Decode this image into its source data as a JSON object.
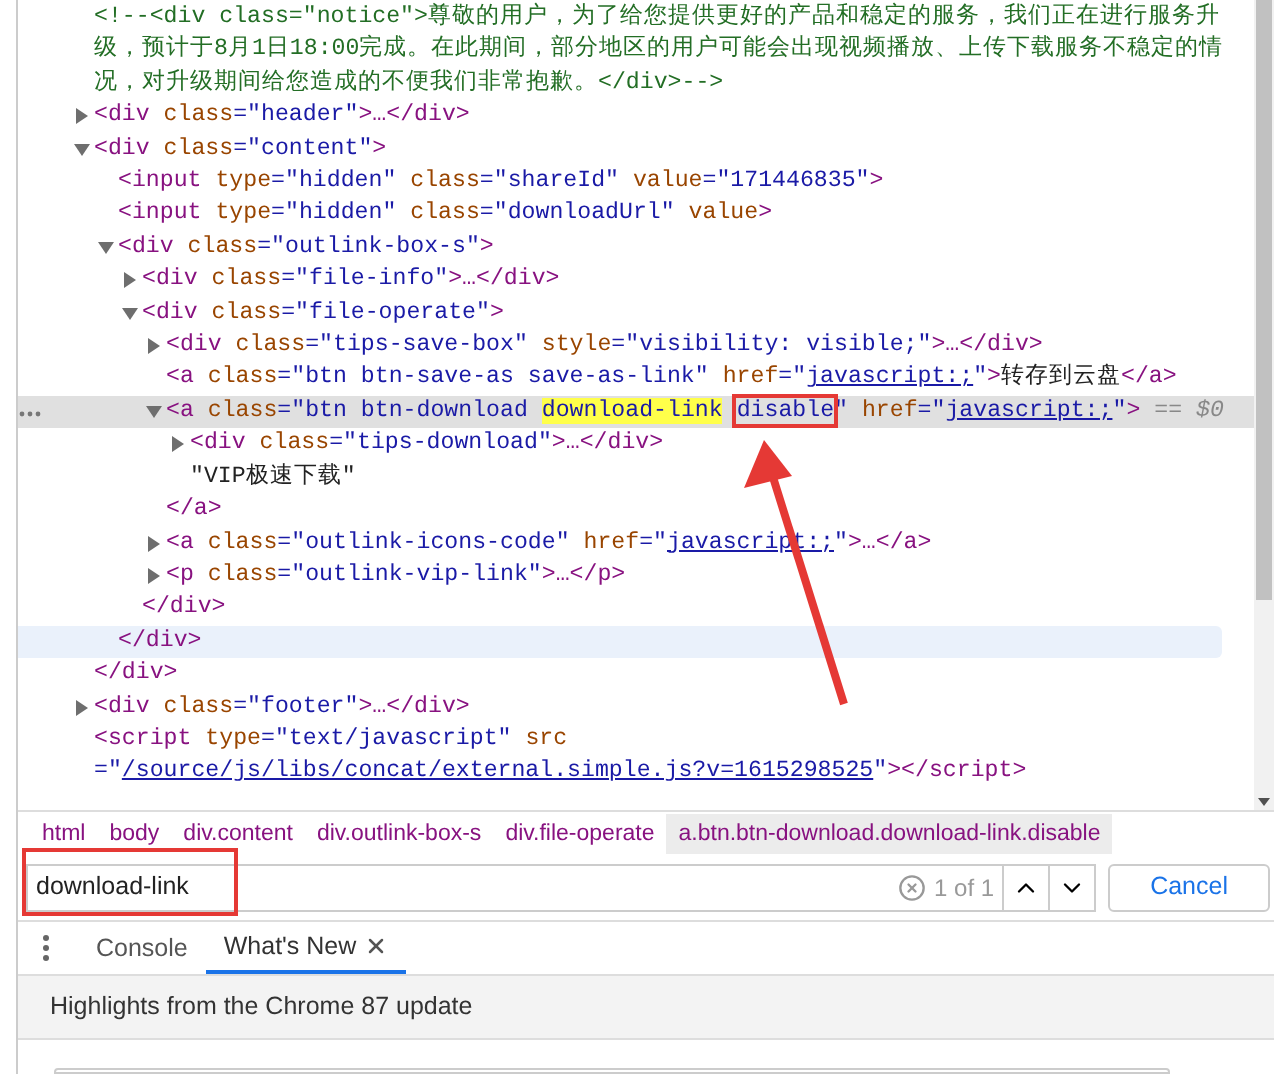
{
  "elements": {
    "nodes": [
      {
        "kind": "comment",
        "text": "<!--<div class=\"notice\">尊敬的用户，为了给您提供更好的产品和稳定的服务，我们正在进行服务升级，预计于8月1日18:00完成。在此期间，部分地区的用户可能会出现视频播放、上传下载服务不稳定的情况，对升级期间给您造成的不便我们非常抱歉。</div>-->"
      },
      {
        "kind": "element",
        "expanded": false,
        "selected": false,
        "tokens": [
          {
            "kind": "tag",
            "text": "<div"
          },
          {
            "kind": "attr",
            "text": " class"
          },
          {
            "kind": "value",
            "text": "=\"header\""
          },
          {
            "kind": "tag",
            "text": ">…</div>"
          }
        ]
      },
      {
        "kind": "element",
        "expanded": true,
        "selected": false,
        "close_hovered": false,
        "tokens": [
          {
            "kind": "tag",
            "text": "<div"
          },
          {
            "kind": "attr",
            "text": " class"
          },
          {
            "kind": "value",
            "text": "=\"content\""
          },
          {
            "kind": "tag",
            "text": ">"
          }
        ],
        "close": "</div>",
        "children": [
          {
            "kind": "element",
            "selected": false,
            "tokens": [
              {
                "kind": "tag",
                "text": "<input"
              },
              {
                "kind": "attr",
                "text": " type"
              },
              {
                "kind": "value",
                "text": "=\"hidden\""
              },
              {
                "kind": "attr",
                "text": " class"
              },
              {
                "kind": "value",
                "text": "=\"shareId\""
              },
              {
                "kind": "attr",
                "text": " value"
              },
              {
                "kind": "value",
                "text": "=\"171446835\""
              },
              {
                "kind": "tag",
                "text": ">"
              }
            ]
          },
          {
            "kind": "element",
            "selected": false,
            "tokens": [
              {
                "kind": "tag",
                "text": "<input"
              },
              {
                "kind": "attr",
                "text": " type"
              },
              {
                "kind": "value",
                "text": "=\"hidden\""
              },
              {
                "kind": "attr",
                "text": " class"
              },
              {
                "kind": "value",
                "text": "=\"downloadUrl\""
              },
              {
                "kind": "attr",
                "text": " value"
              },
              {
                "kind": "tag",
                "text": ">"
              }
            ]
          },
          {
            "kind": "element",
            "expanded": true,
            "selected": false,
            "close_hovered": true,
            "tokens": [
              {
                "kind": "tag",
                "text": "<div"
              },
              {
                "kind": "attr",
                "text": " class"
              },
              {
                "kind": "value",
                "text": "=\"outlink-box-s\""
              },
              {
                "kind": "tag",
                "text": ">"
              }
            ],
            "close": "</div>",
            "children": [
              {
                "kind": "element",
                "expanded": false,
                "selected": false,
                "tokens": [
                  {
                    "kind": "tag",
                    "text": "<div"
                  },
                  {
                    "kind": "attr",
                    "text": " class"
                  },
                  {
                    "kind": "value",
                    "text": "=\"file-info\""
                  },
                  {
                    "kind": "tag",
                    "text": ">…</div>"
                  }
                ]
              },
              {
                "kind": "element",
                "expanded": true,
                "selected": false,
                "close_hovered": false,
                "tokens": [
                  {
                    "kind": "tag",
                    "text": "<div"
                  },
                  {
                    "kind": "attr",
                    "text": " class"
                  },
                  {
                    "kind": "value",
                    "text": "=\"file-operate\""
                  },
                  {
                    "kind": "tag",
                    "text": ">"
                  }
                ],
                "close": "</div>",
                "children": [
                  {
                    "kind": "element",
                    "expanded": false,
                    "selected": false,
                    "tokens": [
                      {
                        "kind": "tag",
                        "text": "<div"
                      },
                      {
                        "kind": "attr",
                        "text": " class"
                      },
                      {
                        "kind": "value",
                        "text": "=\"tips-save-box\""
                      },
                      {
                        "kind": "attr",
                        "text": " style"
                      },
                      {
                        "kind": "value",
                        "text": "=\"visibility: visible;\""
                      },
                      {
                        "kind": "tag",
                        "text": ">…</div>"
                      }
                    ]
                  },
                  {
                    "kind": "element",
                    "selected": false,
                    "tokens": [
                      {
                        "kind": "tag",
                        "text": "<a"
                      },
                      {
                        "kind": "attr",
                        "text": " class"
                      },
                      {
                        "kind": "value",
                        "text": "=\"btn btn-save-as save-as-link\""
                      },
                      {
                        "kind": "attr",
                        "text": " href"
                      },
                      {
                        "kind": "value",
                        "text": "=\""
                      },
                      {
                        "kind": "link",
                        "text": "javascript:;"
                      },
                      {
                        "kind": "value",
                        "text": "\""
                      },
                      {
                        "kind": "tag",
                        "text": ">"
                      },
                      {
                        "kind": "text",
                        "text": "转存到云盘"
                      },
                      {
                        "kind": "tag",
                        "text": "</a>"
                      }
                    ]
                  },
                  {
                    "kind": "element",
                    "expanded": true,
                    "selected": true,
                    "close_hovered": false,
                    "tokens": [
                      {
                        "kind": "tag",
                        "text": "<a"
                      },
                      {
                        "kind": "attr",
                        "text": " class"
                      },
                      {
                        "kind": "value",
                        "text": "=\"btn btn-download "
                      },
                      {
                        "kind": "value",
                        "text": "download-link",
                        "highlight": true
                      },
                      {
                        "kind": "value",
                        "text": "disable",
                        "annotated": true
                      },
                      {
                        "kind": "value",
                        "text": "\""
                      },
                      {
                        "kind": "attr",
                        "text": " href"
                      },
                      {
                        "kind": "value",
                        "text": "=\""
                      },
                      {
                        "kind": "link",
                        "text": "javascript:;"
                      },
                      {
                        "kind": "value",
                        "text": "\""
                      },
                      {
                        "kind": "tag",
                        "text": ">"
                      },
                      {
                        "kind": "hint",
                        "text": " == $0"
                      }
                    ],
                    "close": "</a>",
                    "children": [
                      {
                        "kind": "element",
                        "expanded": false,
                        "selected": false,
                        "tokens": [
                          {
                            "kind": "tag",
                            "text": "<div"
                          },
                          {
                            "kind": "attr",
                            "text": " class"
                          },
                          {
                            "kind": "value",
                            "text": "=\"tips-download\""
                          },
                          {
                            "kind": "tag",
                            "text": ">…</div>"
                          }
                        ]
                      },
                      {
                        "kind": "text",
                        "text": "\"VIP极速下载\""
                      }
                    ]
                  },
                  {
                    "kind": "element",
                    "expanded": false,
                    "selected": false,
                    "tokens": [
                      {
                        "kind": "tag",
                        "text": "<a"
                      },
                      {
                        "kind": "attr",
                        "text": " class"
                      },
                      {
                        "kind": "value",
                        "text": "=\"outlink-icons-code\""
                      },
                      {
                        "kind": "attr",
                        "text": " href"
                      },
                      {
                        "kind": "value",
                        "text": "=\""
                      },
                      {
                        "kind": "link",
                        "text": "javascript:;"
                      },
                      {
                        "kind": "value",
                        "text": "\""
                      },
                      {
                        "kind": "tag",
                        "text": ">…</a>"
                      }
                    ]
                  },
                  {
                    "kind": "element",
                    "expanded": false,
                    "selected": false,
                    "tokens": [
                      {
                        "kind": "tag",
                        "text": "<p"
                      },
                      {
                        "kind": "attr",
                        "text": " class"
                      },
                      {
                        "kind": "value",
                        "text": "=\"outlink-vip-link\""
                      },
                      {
                        "kind": "tag",
                        "text": ">…</p>"
                      }
                    ]
                  }
                ]
              }
            ]
          }
        ]
      },
      {
        "kind": "element",
        "expanded": false,
        "selected": false,
        "tokens": [
          {
            "kind": "tag",
            "text": "<div"
          },
          {
            "kind": "attr",
            "text": " class"
          },
          {
            "kind": "value",
            "text": "=\"footer\""
          },
          {
            "kind": "tag",
            "text": ">…</div>"
          }
        ]
      },
      {
        "kind": "element",
        "selected": false,
        "tokens": [
          {
            "kind": "tag",
            "text": "<script"
          },
          {
            "kind": "attr",
            "text": " type"
          },
          {
            "kind": "value",
            "text": "=\"text/javascript\""
          },
          {
            "kind": "attr",
            "text": " src"
          },
          {
            "kind": "value",
            "text": "=\""
          },
          {
            "kind": "link",
            "text": "/source/js/libs/concat/external.simple.js?v=1615298525"
          },
          {
            "kind": "value",
            "text": "\""
          },
          {
            "kind": "tag",
            "text": "></script>"
          }
        ]
      }
    ]
  },
  "breadcrumb": [
    {
      "label": "html",
      "selected": false
    },
    {
      "label": "body",
      "selected": false
    },
    {
      "label": "div.content",
      "selected": false
    },
    {
      "label": "div.outlink-box-s",
      "selected": false
    },
    {
      "label": "div.file-operate",
      "selected": false
    },
    {
      "label": "a.btn.btn-download.download-link.disable",
      "selected": true
    }
  ],
  "search": {
    "value": "download-link",
    "annotated": true,
    "match_count": "1 of 1",
    "cancel": "Cancel"
  },
  "drawer": {
    "tabs": [
      {
        "label": "Console",
        "selected": false,
        "closable": false
      },
      {
        "label": "What's New",
        "selected": true,
        "closable": true
      }
    ],
    "heading": "Highlights from the Chrome 87 update"
  }
}
